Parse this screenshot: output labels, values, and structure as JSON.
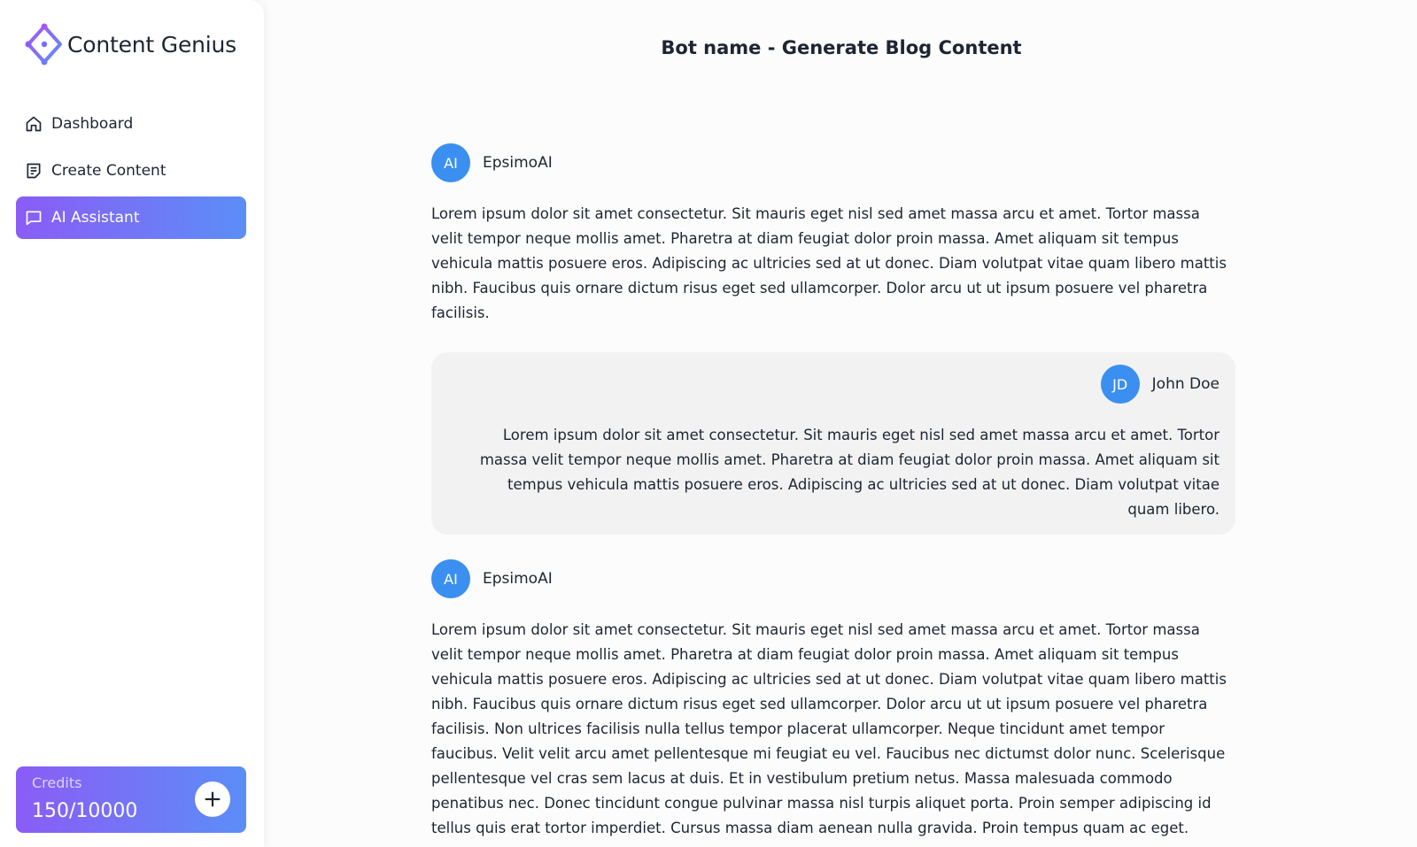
{
  "brand": {
    "name": "Content Genius"
  },
  "nav": {
    "items": [
      {
        "label": "Dashboard",
        "icon": "home-icon"
      },
      {
        "label": "Create Content",
        "icon": "document-icon"
      },
      {
        "label": "AI Assistant",
        "icon": "chat-bubble-icon",
        "active": true
      }
    ]
  },
  "credits": {
    "label": "Credits",
    "value": "150/10000"
  },
  "page": {
    "title": "Bot name - Generate Blog Content"
  },
  "messages": [
    {
      "initials": "AI",
      "sender": "EpsimoAI",
      "text": "Lorem ipsum dolor sit amet consectetur. Sit mauris eget nisl sed amet massa arcu et amet. Tortor massa velit tempor neque mollis amet. Pharetra at diam feugiat dolor proin massa. Amet aliquam sit tempus vehicula mattis posuere eros. Adipiscing ac ultricies sed at ut donec. Diam volutpat vitae quam libero mattis nibh. Faucibus quis ornare dictum risus eget sed ullamcorper. Dolor arcu ut ut ipsum posuere vel pharetra facilisis."
    },
    {
      "initials": "JD",
      "sender": "John Doe",
      "text": "Lorem ipsum dolor sit amet consectetur. Sit mauris eget nisl sed amet massa arcu et amet. Tortor massa velit tempor neque mollis amet. Pharetra at diam feugiat dolor proin massa. Amet aliquam sit tempus vehicula mattis posuere eros. Adipiscing ac ultricies sed at ut donec. Diam volutpat vitae quam libero."
    },
    {
      "initials": "AI",
      "sender": "EpsimoAI",
      "text": "Lorem ipsum dolor sit amet consectetur. Sit mauris eget nisl sed amet massa arcu et amet. Tortor massa velit tempor neque mollis amet. Pharetra at diam feugiat dolor proin massa. Amet aliquam sit tempus vehicula mattis posuere eros. Adipiscing ac ultricies sed at ut donec. Diam volutpat vitae quam libero mattis nibh. Faucibus quis ornare dictum risus eget sed ullamcorper. Dolor arcu ut ut ipsum posuere vel pharetra facilisis. Non ultrices facilisis nulla tellus tempor placerat ullamcorper. Neque tincidunt amet tempor faucibus. Velit velit arcu amet pellentesque mi feugiat eu vel. Faucibus nec dictumst dolor nunc. Scelerisque pellentesque vel cras sem lacus at duis. Et in vestibulum pretium netus. Massa malesuada commodo penatibus nec. Donec tincidunt congue pulvinar massa nisl turpis aliquet porta. Proin semper adipiscing id tellus quis erat tortor imperdiet. Cursus massa diam aenean nulla gravida. Proin tempus quam ac eget."
    }
  ],
  "colors": {
    "accent_start": "#8b5cf6",
    "accent_end": "#5b8ef7",
    "avatar": "#3b8ff0",
    "user_bubble": "#f2f2f2",
    "text": "#1d2533"
  }
}
